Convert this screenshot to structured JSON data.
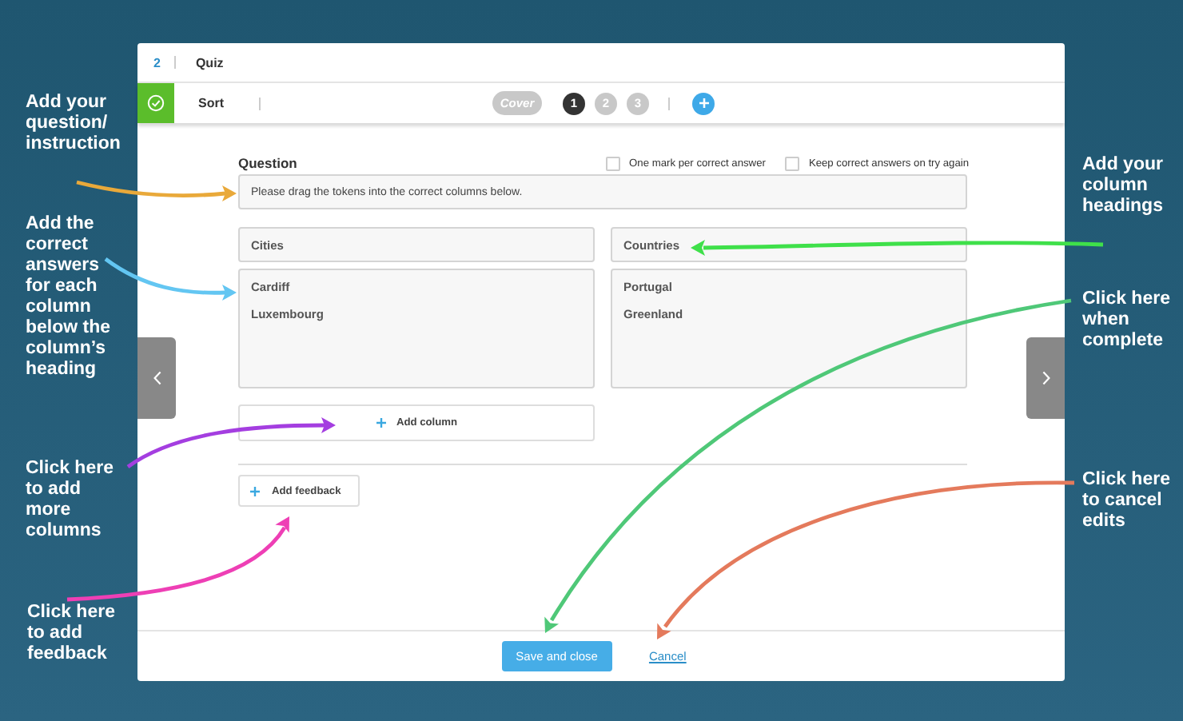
{
  "header": {
    "number": "2",
    "title": "Quiz"
  },
  "toolbar": {
    "complete": true,
    "label": "Sort",
    "pages": [
      {
        "label": "Cover",
        "kind": "cover",
        "selected": false
      },
      {
        "label": "1",
        "kind": "page",
        "selected": true
      },
      {
        "label": "2",
        "kind": "page",
        "selected": false
      },
      {
        "label": "3",
        "kind": "page",
        "selected": false
      }
    ]
  },
  "question": {
    "label": "Question",
    "value": "Please drag the tokens into the correct columns below.",
    "options": [
      {
        "label": "One mark per correct answer",
        "checked": false
      },
      {
        "label": "Keep correct answers on try again",
        "checked": false
      }
    ]
  },
  "columns": [
    {
      "heading": "Cities",
      "answers": [
        "Cardiff",
        "Luxembourg"
      ]
    },
    {
      "heading": "Countries",
      "answers": [
        "Portugal",
        "Greenland"
      ]
    }
  ],
  "add_column": "Add column",
  "add_feedback": "Add feedback",
  "footer": {
    "save": "Save and close",
    "cancel": "Cancel"
  },
  "annotations": [
    {
      "text": "Add your question/ instruction",
      "color": "#e9a93a"
    },
    {
      "text": "Add the correct answers for each column below the column’s heading",
      "color": "#63c6f2"
    },
    {
      "text": "Click here to add more columns",
      "color": "#a43ee0"
    },
    {
      "text": "Click here to add feedback",
      "color": "#ee3fb5"
    },
    {
      "text": "Add your column headings",
      "color": "#3fe04a"
    },
    {
      "text": "Click here when complete",
      "color": "#4fc878"
    },
    {
      "text": "Click here to cancel edits",
      "color": "#e47a5c"
    }
  ]
}
